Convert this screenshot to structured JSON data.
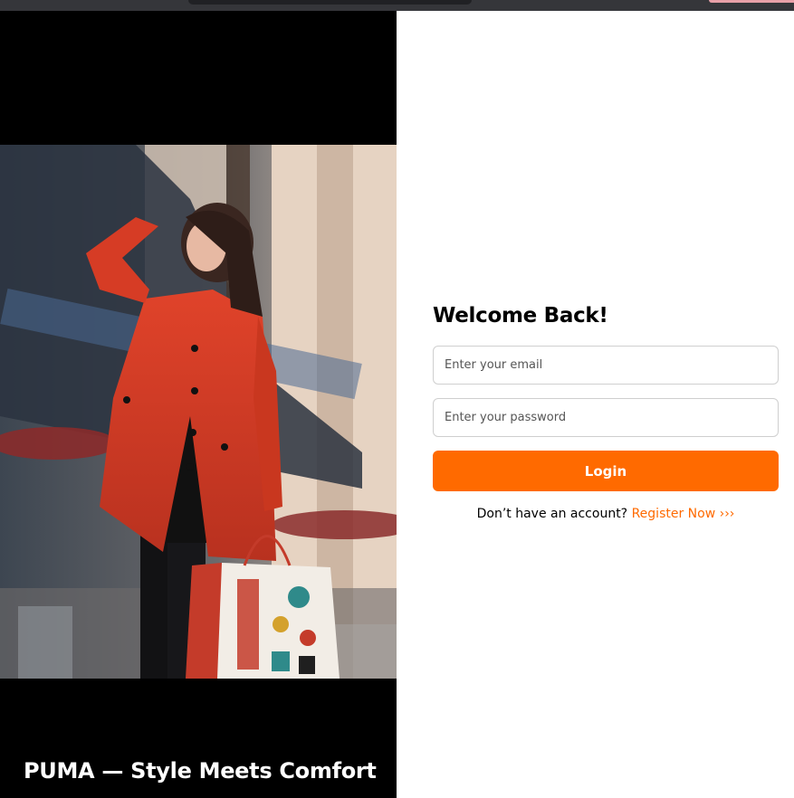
{
  "hero": {
    "tagline": "PUMA — Style Meets Comfort",
    "image_alt": "woman in red coat holding shopping bags"
  },
  "login": {
    "title": "Welcome Back!",
    "email_placeholder": "Enter your email",
    "email_value": "",
    "password_placeholder": "Enter your password",
    "password_value": "",
    "login_label": "Login",
    "signup_prompt": "Don’t have an account?",
    "register_label": "Register Now ›››"
  },
  "colors": {
    "accent": "#ff6a00",
    "hero_background": "#000000"
  }
}
